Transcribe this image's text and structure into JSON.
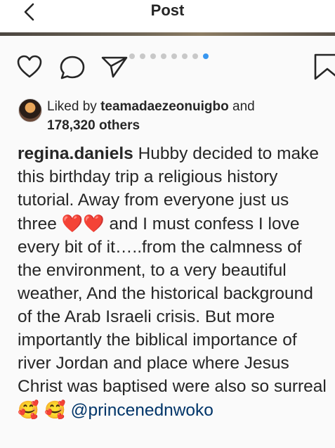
{
  "header": {
    "title": "Post",
    "back_icon": "chevron-left-icon"
  },
  "actions": {
    "like_icon": "heart-outline-icon",
    "comment_icon": "comment-bubble-icon",
    "share_icon": "paper-plane-icon",
    "save_icon": "bookmark-icon"
  },
  "carousel": {
    "total": 8,
    "active_index": 7,
    "active_color": "#3897f0",
    "inactive_color": "#c8c8c8"
  },
  "likes": {
    "prefix": "Liked by",
    "user": "teamadaezeonuigbo",
    "connector": "and",
    "others": "178,320 others"
  },
  "caption": {
    "username": "regina.daniels",
    "text_part1": "Hubby decided to make this birthday trip a religious history tutorial. Away from everyone just us three",
    "hearts": "❤️❤️",
    "text_part2": "and I must confess I love every bit of it…..from the calmness of the environment, to a very beautiful weather, And the historical background of the Arab Israeli crisis. But more importantly the biblical importance of river Jordan and place where Jesus Christ was baptised were also so surreal",
    "emoji_faces": "🥰 🥰",
    "mention": "@princenednwoko"
  }
}
